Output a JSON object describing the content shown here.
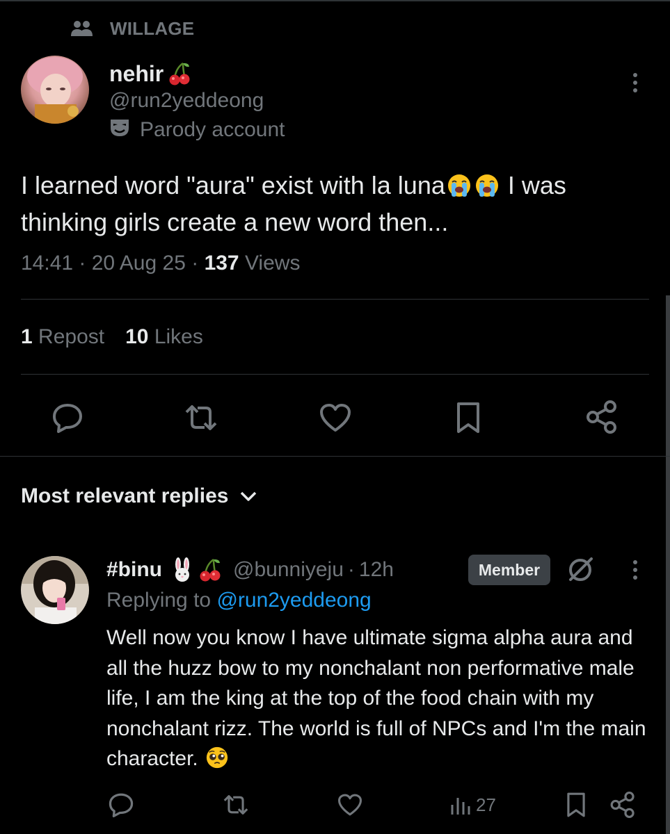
{
  "community": {
    "name": "WILLAGE",
    "icon": "community-people-icon"
  },
  "post": {
    "author": {
      "name": "nehir",
      "name_emoji": "cherries",
      "handle": "@run2yeddeong",
      "label": "Parody account",
      "label_icon": "drama-masks-icon"
    },
    "text_part1": "I learned word \"aura\" exist with la luna",
    "text_emoji": "loudly-crying-face",
    "text_part2": " I was thinking girls create a new word then...",
    "time": "14:41",
    "date": "20 Aug 25",
    "views_count": "137",
    "views_label": "Views",
    "reposts_count": "1",
    "reposts_label": "Repost",
    "likes_count": "10",
    "likes_label": "Likes",
    "actions": [
      "reply-icon",
      "repost-icon",
      "like-icon",
      "bookmark-icon",
      "share-icon"
    ]
  },
  "replies_header": {
    "label": "Most relevant replies",
    "icon": "chevron-down-icon"
  },
  "reply": {
    "name": "#binu",
    "name_emojis": [
      "rabbit-face",
      "cherries"
    ],
    "handle": "@bunniyeju",
    "time": "12h",
    "badge": "Member",
    "replying_prefix": "Replying to",
    "replying_to": "@run2yeddeong",
    "text": "Well now you know I have ultimate sigma alpha aura and all the huzz bow to my nonchalant non performative male life, I am the king at the top of the food chain with my nonchalant rizz. The world is full of NPCs and I'm the main character.",
    "text_emoji": "pleading-face",
    "views_count": "27"
  },
  "colors": {
    "background": "#000000",
    "text": "#e7e9ea",
    "muted": "#71767b",
    "link": "#1d9bf0",
    "divider": "#2f3336",
    "badge_bg": "#3c4146"
  }
}
